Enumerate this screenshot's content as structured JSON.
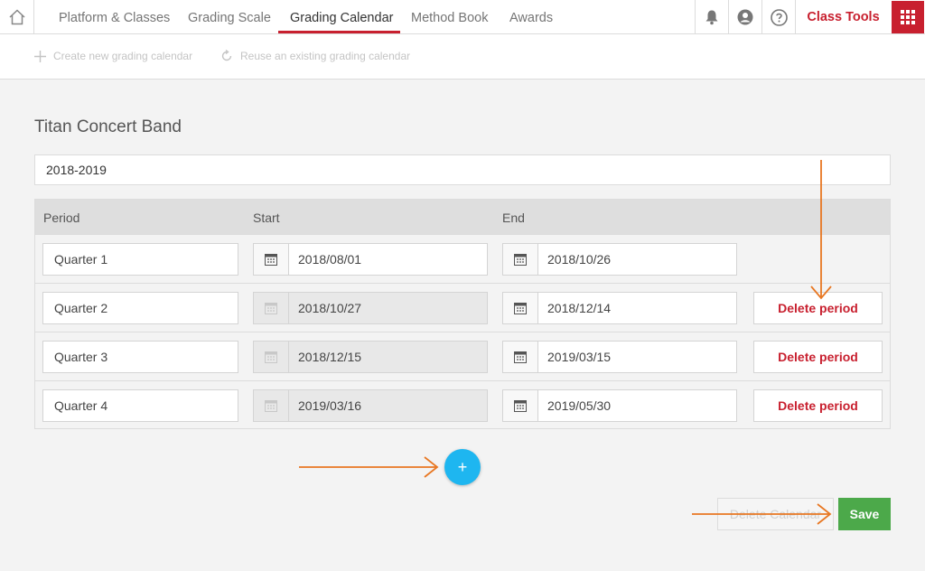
{
  "nav": {
    "tabs": [
      {
        "label": "Platform & Classes"
      },
      {
        "label": "Grading Scale"
      },
      {
        "label": "Grading Calendar"
      },
      {
        "label": "Method Book"
      },
      {
        "label": "Awards"
      }
    ],
    "class_tools": "Class Tools"
  },
  "toolbar": {
    "create_label": "Create new grading calendar",
    "reuse_label": "Reuse an existing grading calendar"
  },
  "calendar": {
    "title": "Titan Concert Band",
    "year": "2018-2019",
    "columns": {
      "period": "Period",
      "start": "Start",
      "end": "End"
    },
    "periods": [
      {
        "name": "Quarter 1",
        "start": "2018/08/01",
        "end": "2018/10/26",
        "delete_label": ""
      },
      {
        "name": "Quarter 2",
        "start": "2018/10/27",
        "end": "2018/12/14",
        "delete_label": "Delete period"
      },
      {
        "name": "Quarter 3",
        "start": "2018/12/15",
        "end": "2019/03/15",
        "delete_label": "Delete period"
      },
      {
        "name": "Quarter 4",
        "start": "2019/03/16",
        "end": "2019/05/30",
        "delete_label": "Delete period"
      }
    ]
  },
  "actions": {
    "add_label": "+",
    "delete_calendar_label": "Delete Calendar",
    "save_label": "Save"
  },
  "colors": {
    "accent": "#c8202f",
    "add_button": "#1eb6f0",
    "save_button": "#4ca94a",
    "annotation_arrow": "#e87722"
  }
}
